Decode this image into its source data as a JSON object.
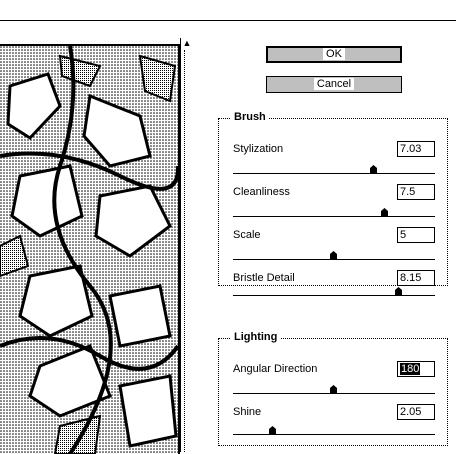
{
  "buttons": {
    "ok": "OK",
    "cancel": "Cancel"
  },
  "brush": {
    "title": "Brush",
    "controls": [
      {
        "label": "Stylization",
        "value": "7.03",
        "level": 0.7
      },
      {
        "label": "Cleanliness",
        "value": "7.5",
        "level": 0.75
      },
      {
        "label": "Scale",
        "value": "5",
        "level": 0.5
      },
      {
        "label": "Bristle Detail",
        "value": "8.15",
        "level": 0.82
      }
    ]
  },
  "lighting": {
    "title": "Lighting",
    "controls": [
      {
        "label": "Angular Direction",
        "value": "180",
        "level": 0.5,
        "selected": true
      },
      {
        "label": "Shine",
        "value": "2.05",
        "level": 0.2
      }
    ]
  },
  "icons": {
    "scroll_up": "scroll-up-arrow-icon"
  }
}
